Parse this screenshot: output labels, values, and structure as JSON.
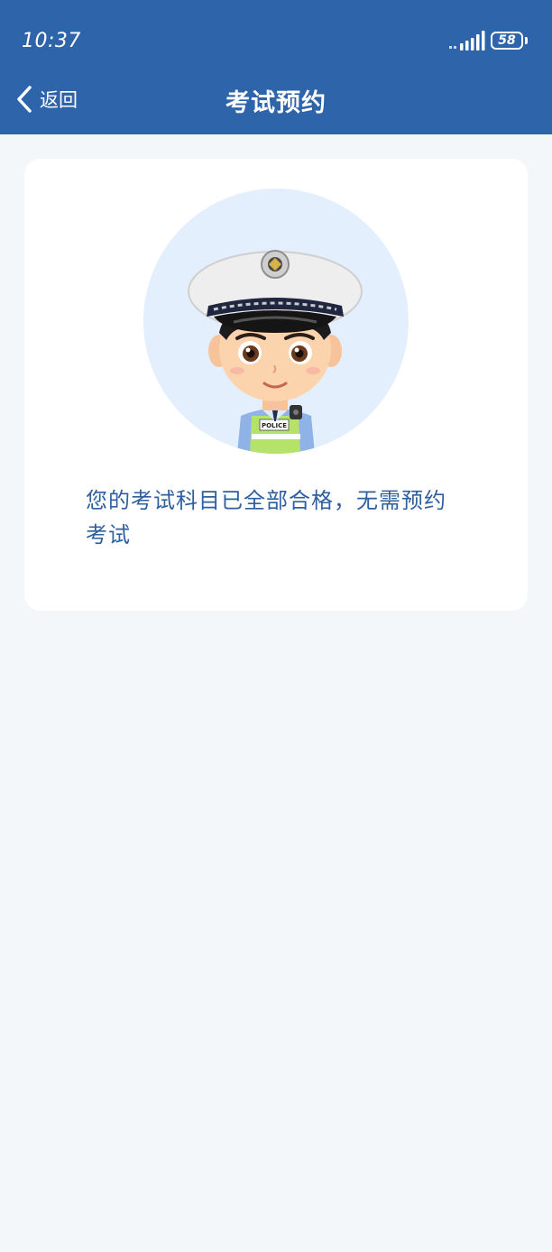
{
  "status_bar": {
    "time": "10:37",
    "battery": "58"
  },
  "nav": {
    "back_label": "返回",
    "title": "考试预约"
  },
  "card": {
    "avatar_badge_text": "POLICE",
    "message": "您的考试科目已全部合格，无需预约考试"
  },
  "colors": {
    "header_bg": "#2d64aa",
    "page_bg": "#f3f7fa",
    "message_text": "#2e5f9f",
    "avatar_bg": "#e3effd"
  },
  "icons": {
    "back": "chevron-left-icon",
    "signal": "signal-icon",
    "battery": "battery-icon"
  }
}
